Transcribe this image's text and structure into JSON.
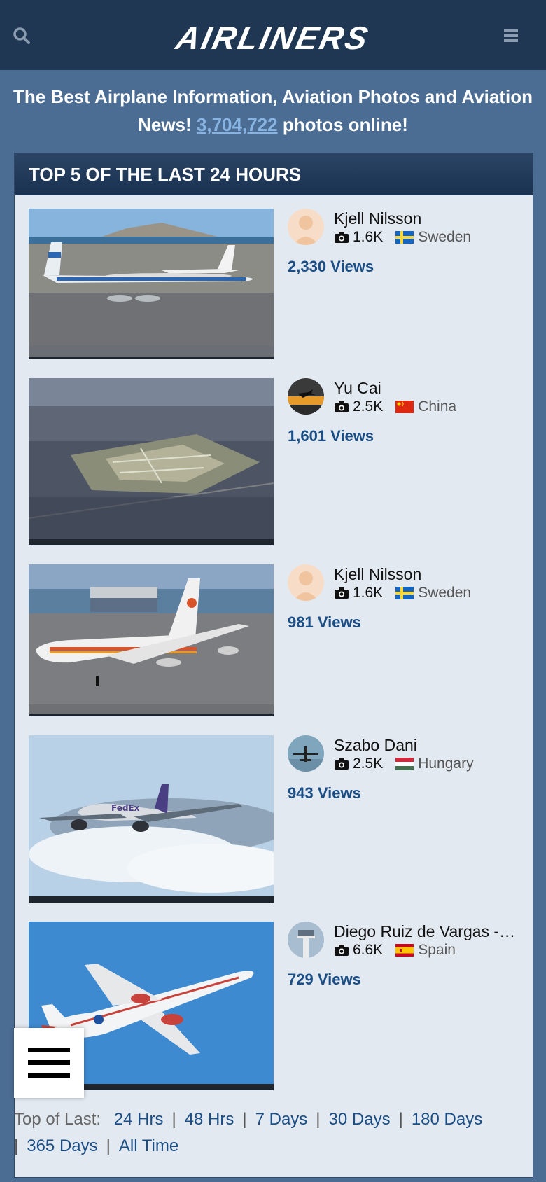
{
  "header": {
    "logo_text": "AIRLINERS",
    "search_icon": "search-icon",
    "menu_icon": "hamburger-menu-icon"
  },
  "tagline": {
    "before": "The Best Airplane Information, Aviation Photos and Aviation News!",
    "count": "3,704,722",
    "after": "photos online!"
  },
  "top5": {
    "title": "TOP 5 OF THE LAST 24 HOURS",
    "items": [
      {
        "user": "Kjell Nilsson",
        "photos": "1.6K",
        "country": "Sweden",
        "views": "2,330 Views"
      },
      {
        "user": "Yu Cai",
        "photos": "2.5K",
        "country": "China",
        "views": "1,601 Views"
      },
      {
        "user": "Kjell Nilsson",
        "photos": "1.6K",
        "country": "Sweden",
        "views": "981 Views"
      },
      {
        "user": "Szabo Dani",
        "photos": "2.5K",
        "country": "Hungary",
        "views": "943 Views"
      },
      {
        "user": "Diego Ruiz de Vargas - I...",
        "photos": "6.6K",
        "country": "Spain",
        "views": "729 Views"
      }
    ]
  },
  "timeframe": {
    "label": "Top of Last:",
    "links": [
      "24 Hrs",
      "48 Hrs",
      "7 Days",
      "30 Days",
      "180 Days",
      "365 Days",
      "All Time"
    ]
  },
  "colors": {
    "topbar": "#1f3752",
    "page_bg": "#4b6c93",
    "panel_bg": "#e3e9f1",
    "link_blue": "#1a4e85"
  }
}
